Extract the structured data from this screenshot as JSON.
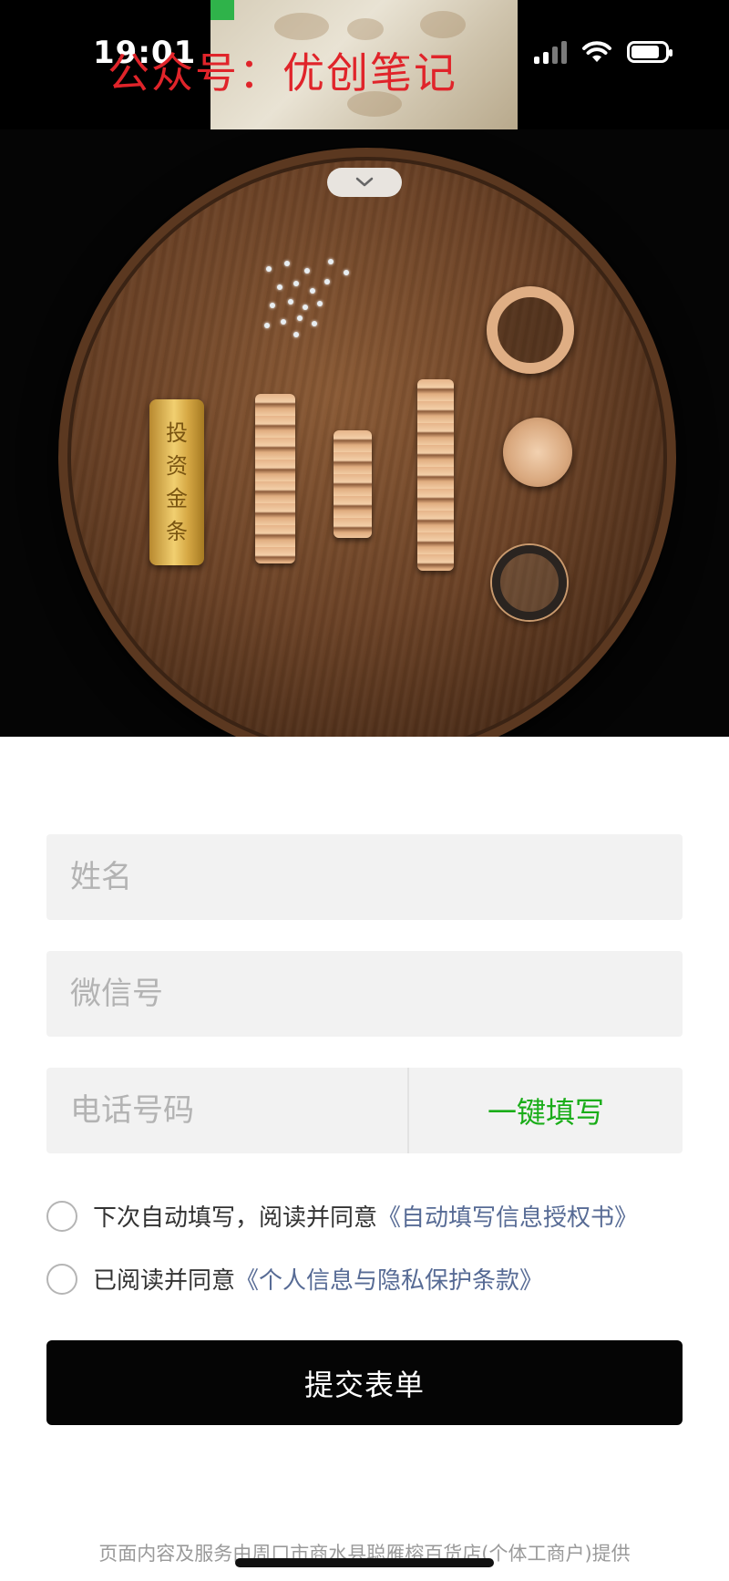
{
  "status_bar": {
    "time": "19:01",
    "watermark": "公众号：优创笔记",
    "icons": [
      "signal-icon",
      "wifi-icon",
      "battery-icon"
    ]
  },
  "hero": {
    "collapse_icon": "chevron-down-icon",
    "gold_bar_text": [
      "投",
      "资",
      "金",
      "条"
    ]
  },
  "form": {
    "name_placeholder": "姓名",
    "wechat_placeholder": "微信号",
    "phone_placeholder": "电话号码",
    "autofill_button": "一键填写",
    "consent_autofill": {
      "text": "下次自动填写，阅读并同意",
      "link": "《自动填写信息授权书》"
    },
    "consent_privacy": {
      "text": "已阅读并同意",
      "link": "《个人信息与隐私保护条款》"
    },
    "submit_label": "提交表单"
  },
  "footer": {
    "text": "页面内容及服务由周口市商水县聪雁榕百货店(个体工商户)提供"
  },
  "colors": {
    "accent_green": "#1aad19",
    "link_blue": "#576b95",
    "button_black": "#050505",
    "field_bg": "#f2f2f2",
    "watermark_red": "#e0242a"
  }
}
